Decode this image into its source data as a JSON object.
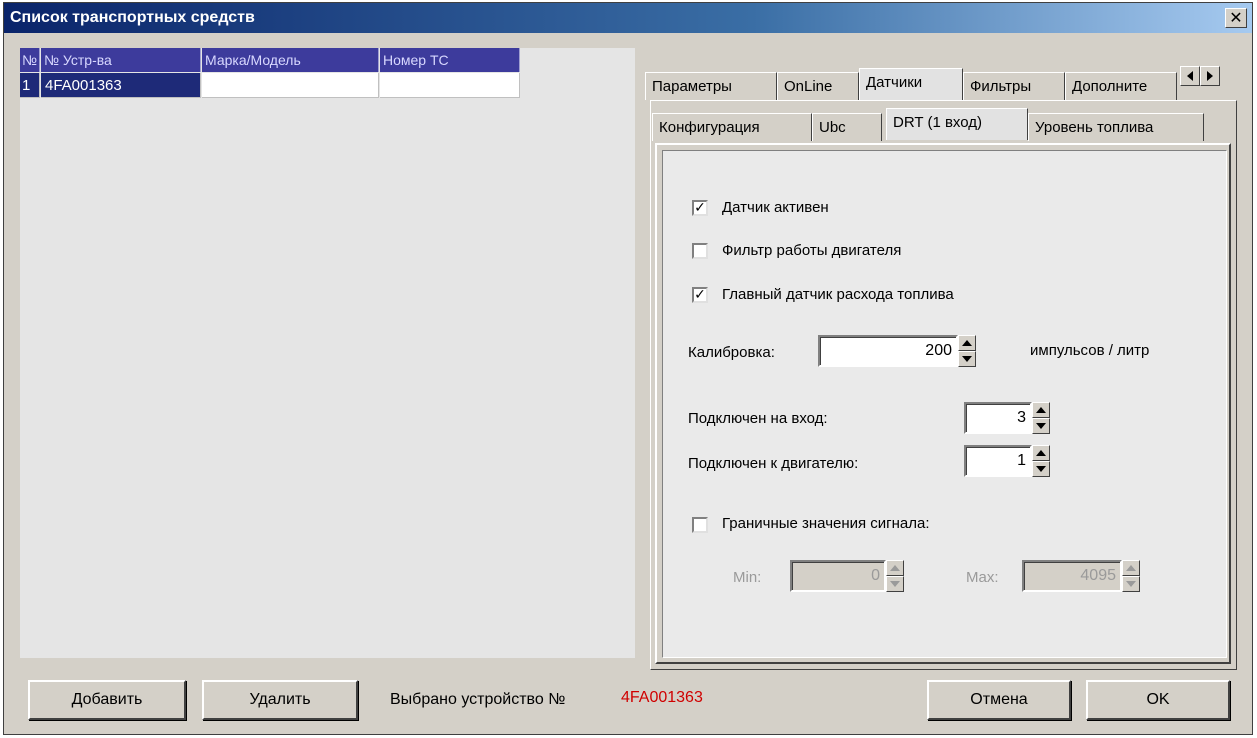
{
  "window": {
    "title": "Список транспортных средств",
    "close_glyph": "✕"
  },
  "grid": {
    "columns": [
      "№",
      "№ Устр-ва",
      "Марка/Модель",
      "Номер ТС"
    ],
    "rows": [
      {
        "num": "1",
        "device": "4FA001363",
        "model": "",
        "plate": ""
      }
    ]
  },
  "tabs": {
    "main": [
      "Параметры",
      "OnLine",
      "Датчики",
      "Фильтры",
      "Дополните"
    ],
    "main_active": "Датчики",
    "sub": [
      "Конфигурация",
      "Ubc",
      "DRT (1 вход)",
      "Уровень топлива"
    ],
    "sub_active": "DRT (1 вход)"
  },
  "sensor": {
    "active": {
      "label": "Датчик активен",
      "checked": true,
      "check_glyph": "✓"
    },
    "engine_filter": {
      "label": "Фильтр работы двигателя",
      "checked": false
    },
    "main_fuel": {
      "label": "Главный датчик расхода топлива",
      "checked": true,
      "check_glyph": "✓"
    },
    "calibration": {
      "label": "Калибровка:",
      "value": "200",
      "unit": "импульсов / литр"
    },
    "input": {
      "label": "Подключен на вход:",
      "value": "3"
    },
    "engine": {
      "label": "Подключен к двигателю:",
      "value": "1"
    },
    "limits": {
      "label": "Граничные значения сигнала:",
      "checked": false,
      "min_label": "Min:",
      "min_value": "0",
      "max_label": "Max:",
      "max_value": "4095"
    }
  },
  "footer": {
    "add_label": "Добавить",
    "delete_label": "Удалить",
    "selected_label": "Выбрано устройство №",
    "selected_value": "4FA001363",
    "selected_color": "#d00000",
    "cancel_label": "Отмена",
    "ok_label": "OK"
  },
  "colors": {
    "title_start": "#0a246a",
    "grid_header": "#3d3b9c",
    "selected_row": "#1e2a78"
  }
}
